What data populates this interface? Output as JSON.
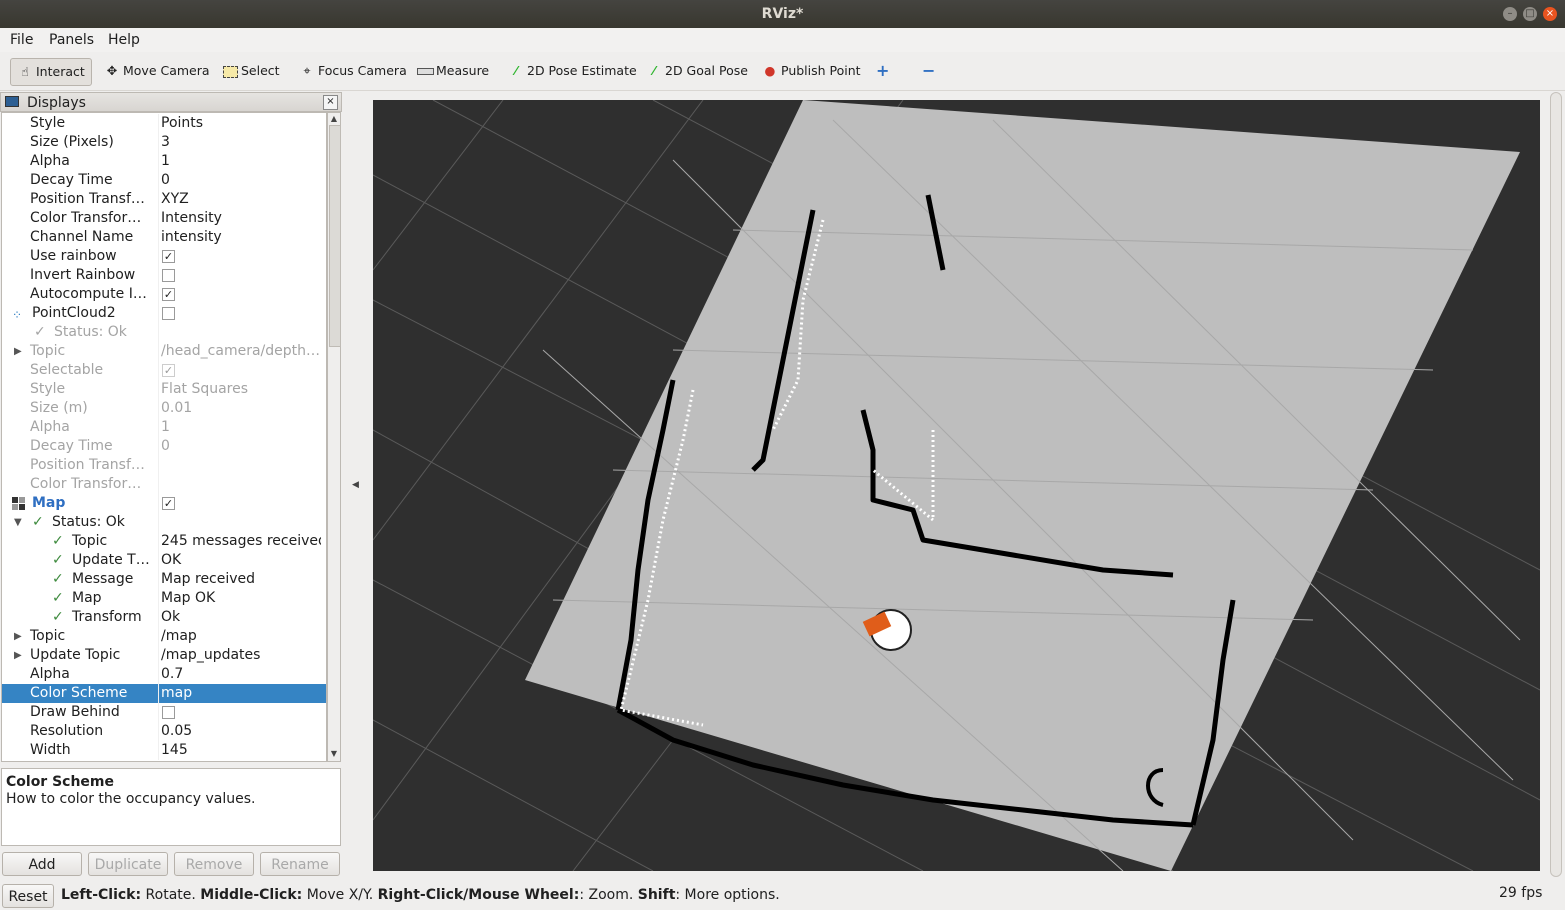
{
  "window": {
    "title": "RViz*"
  },
  "menu": [
    "File",
    "Panels",
    "Help"
  ],
  "toolbar": {
    "tools": [
      {
        "label": "Interact",
        "icon": "cursor-icon"
      },
      {
        "label": "Move Camera",
        "icon": "move-icon"
      },
      {
        "label": "Select",
        "icon": "select-icon"
      },
      {
        "label": "Focus Camera",
        "icon": "focus-icon"
      },
      {
        "label": "Measure",
        "icon": "ruler-icon"
      },
      {
        "label": "2D Pose Estimate",
        "icon": "green-arrow-icon"
      },
      {
        "label": "2D Goal Pose",
        "icon": "green-arrow-icon"
      },
      {
        "label": "Publish Point",
        "icon": "pin-icon"
      }
    ]
  },
  "displays": {
    "title": "Displays",
    "rows": [
      {
        "name": "Style",
        "value": "Points"
      },
      {
        "name": "Size (Pixels)",
        "value": "3"
      },
      {
        "name": "Alpha",
        "value": "1"
      },
      {
        "name": "Decay Time",
        "value": "0"
      },
      {
        "name": "Position Transf…",
        "value": "XYZ"
      },
      {
        "name": "Color Transfor…",
        "value": "Intensity"
      },
      {
        "name": "Channel Name",
        "value": "intensity"
      },
      {
        "name": "Use rainbow",
        "value": "",
        "check": "checked"
      },
      {
        "name": "Invert Rainbow",
        "value": "",
        "check": "unchecked"
      },
      {
        "name": "Autocompute I…",
        "value": "",
        "check": "checked"
      },
      {
        "name": "PointCloud2",
        "value": "",
        "check": "unchecked"
      },
      {
        "name": "Status: Ok",
        "value": ""
      },
      {
        "name": "Topic",
        "value": "/head_camera/depth…"
      },
      {
        "name": "Selectable",
        "value": "",
        "check": "checked"
      },
      {
        "name": "Style",
        "value": "Flat Squares"
      },
      {
        "name": "Size (m)",
        "value": "0.01"
      },
      {
        "name": "Alpha",
        "value": "1"
      },
      {
        "name": "Decay Time",
        "value": "0"
      },
      {
        "name": "Position Transf…",
        "value": ""
      },
      {
        "name": "Color Transfor…",
        "value": ""
      },
      {
        "name": "Map",
        "value": "",
        "check": "checked"
      },
      {
        "name": "Status: Ok",
        "value": ""
      },
      {
        "name": "Topic",
        "value": "245 messages received"
      },
      {
        "name": "Update T…",
        "value": "OK"
      },
      {
        "name": "Message",
        "value": "Map received"
      },
      {
        "name": "Map",
        "value": "Map OK"
      },
      {
        "name": "Transform",
        "value": "Ok"
      },
      {
        "name": "Topic",
        "value": "/map"
      },
      {
        "name": "Update Topic",
        "value": "/map_updates"
      },
      {
        "name": "Alpha",
        "value": "0.7"
      },
      {
        "name": "Color Scheme",
        "value": "map"
      },
      {
        "name": "Draw Behind",
        "value": "",
        "check": "unchecked"
      },
      {
        "name": "Resolution",
        "value": "0.05"
      },
      {
        "name": "Width",
        "value": "145"
      }
    ]
  },
  "description": {
    "title": "Color Scheme",
    "text": "How to color the occupancy values."
  },
  "buttons": {
    "add": "Add",
    "duplicate": "Duplicate",
    "remove": "Remove",
    "rename": "Rename"
  },
  "status": {
    "reset": "Reset",
    "parts": [
      {
        "b": "Left-Click:",
        "t": " Rotate. "
      },
      {
        "b": "Middle-Click:",
        "t": " Move X/Y. "
      },
      {
        "b": "Right-Click/Mouse Wheel:",
        "t": ": Zoom. "
      },
      {
        "b": "Shift",
        "t": ": More options."
      }
    ],
    "fps": "29 fps"
  },
  "colors": {
    "map_free": "#bebebe",
    "map_occupied": "#000000",
    "background": "#303030",
    "selection": "#3584c4",
    "status_ok": "#3d8a3d"
  }
}
